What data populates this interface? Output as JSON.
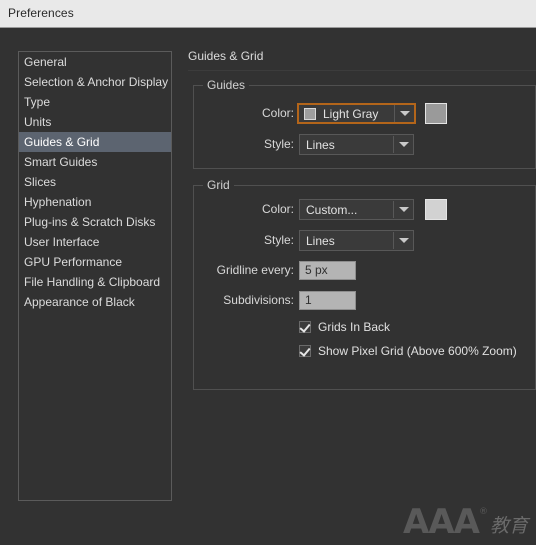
{
  "window": {
    "title": "Preferences"
  },
  "sidebar": {
    "items": [
      {
        "label": "General",
        "selected": false
      },
      {
        "label": "Selection & Anchor Display",
        "selected": false
      },
      {
        "label": "Type",
        "selected": false
      },
      {
        "label": "Units",
        "selected": false
      },
      {
        "label": "Guides & Grid",
        "selected": true
      },
      {
        "label": "Smart Guides",
        "selected": false
      },
      {
        "label": "Slices",
        "selected": false
      },
      {
        "label": "Hyphenation",
        "selected": false
      },
      {
        "label": "Plug-ins & Scratch Disks",
        "selected": false
      },
      {
        "label": "User Interface",
        "selected": false
      },
      {
        "label": "GPU Performance",
        "selected": false
      },
      {
        "label": "File Handling & Clipboard",
        "selected": false
      },
      {
        "label": "Appearance of Black",
        "selected": false
      }
    ]
  },
  "panel": {
    "title": "Guides & Grid",
    "guides": {
      "legend": "Guides",
      "color_label": "Color:",
      "color_value": "Light Gray",
      "color_swatch_inline": "#9e9e9e",
      "color_swatch_button": "#9a9a9a",
      "style_label": "Style:",
      "style_value": "Lines"
    },
    "grid": {
      "legend": "Grid",
      "color_label": "Color:",
      "color_value": "Custom...",
      "color_swatch_button": "#d2d2d2",
      "style_label": "Style:",
      "style_value": "Lines",
      "gridline_every_label": "Gridline every:",
      "gridline_every_value": "5 px",
      "subdivisions_label": "Subdivisions:",
      "subdivisions_value": "1",
      "grids_in_back_label": "Grids In Back",
      "grids_in_back_checked": true,
      "show_pixel_grid_label": "Show Pixel Grid (Above 600% Zoom)",
      "show_pixel_grid_checked": true
    }
  },
  "watermark": {
    "primary": "AAA",
    "registered": "®",
    "secondary": "教育"
  },
  "colors": {
    "accent_focus": "#b3651a",
    "selection": "#5c6470",
    "dialog_bg": "#323232",
    "titlebar_bg": "#e9e9e9"
  }
}
